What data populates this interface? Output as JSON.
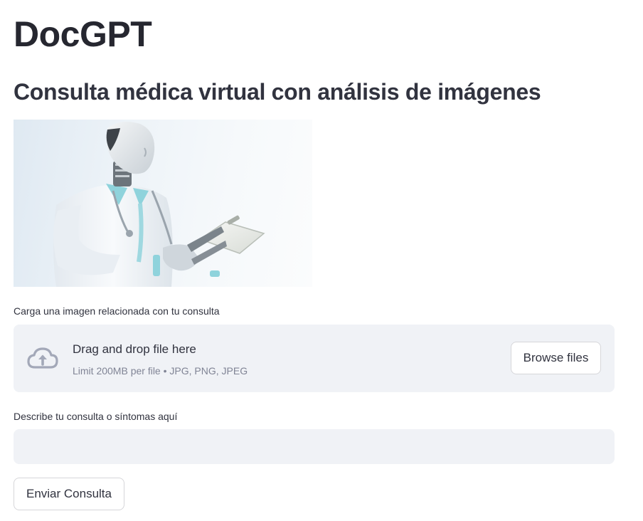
{
  "app": {
    "title": "DocGPT",
    "subtitle": "Consulta médica virtual con análisis de imágenes"
  },
  "hero_image": {
    "description_icon": "robot-doctor-illustration"
  },
  "uploader": {
    "label": "Carga una imagen relacionada con tu consulta",
    "drop_text": "Drag and drop file here",
    "limit_text": "Limit 200MB per file • JPG, PNG, JPEG",
    "browse_label": "Browse files",
    "icon": "cloud-upload-icon"
  },
  "query": {
    "label": "Describe tu consulta o síntomas aquí",
    "value": "",
    "placeholder": ""
  },
  "actions": {
    "submit_label": "Enviar Consulta"
  },
  "colors": {
    "panel_bg": "#f0f2f6",
    "text": "#31333f",
    "muted": "#808495",
    "icon": "#a3a8b8"
  }
}
